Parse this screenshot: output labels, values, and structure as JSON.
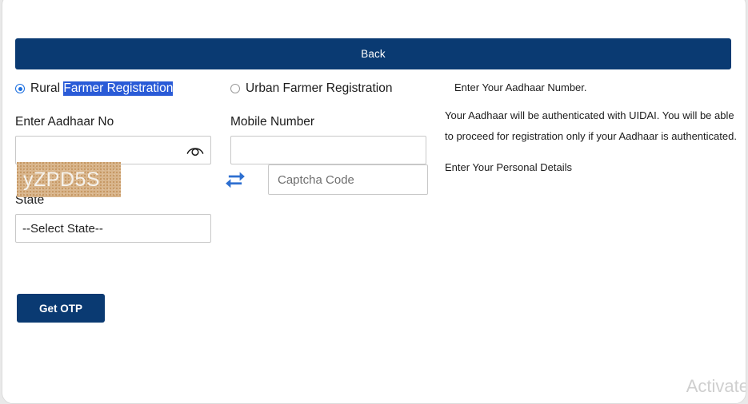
{
  "nav": {
    "back_label": "Back"
  },
  "registration_type": {
    "rural": {
      "label_plain": "Rural ",
      "label_selected": "Farmer Registration",
      "checked": true
    },
    "urban": {
      "label": "Urban Farmer Registration",
      "checked": false
    }
  },
  "fields": {
    "aadhaar": {
      "label": "Enter Aadhaar No",
      "value": "",
      "placeholder": "",
      "icon": "eye-icon"
    },
    "mobile": {
      "label": "Mobile Number",
      "value": "",
      "placeholder": ""
    },
    "state": {
      "label": "State",
      "selected": "--Select State--",
      "options": [
        "--Select State--"
      ]
    },
    "captcha": {
      "image_text": "yZPD5S",
      "refresh_icon": "refresh-icon",
      "input_value": "",
      "input_placeholder": "Captcha Code"
    }
  },
  "actions": {
    "get_otp_label": "Get OTP"
  },
  "info_panel": {
    "lead": "Enter Your Aadhaar Number.",
    "body": "Your Aadhaar will be authenticated with UIDAI. You will be able to proceed for registration only if your Aadhaar is authenticated.",
    "tail": "Enter Your Personal Details"
  },
  "watermark": {
    "text": "Activate"
  },
  "colors": {
    "navy": "#0a3a72",
    "selection_blue": "#2a5bd7",
    "radio_blue": "#1c6fe0",
    "captcha_bg": "#d9b68d",
    "page_bg": "#e9e9e9",
    "border_gray": "#c8c8c8"
  }
}
